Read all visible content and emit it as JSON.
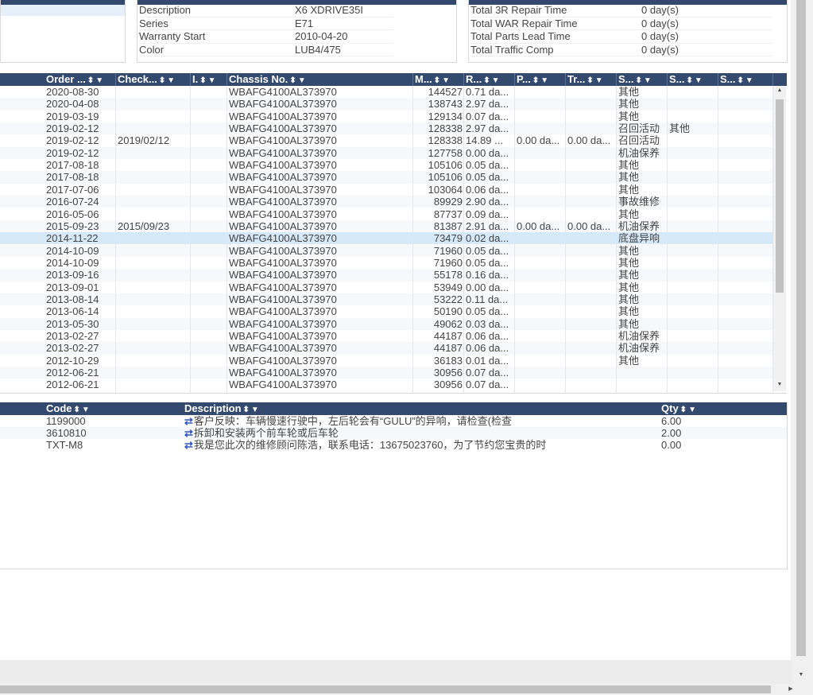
{
  "vehicle_info": {
    "rows": [
      {
        "label": "Description",
        "value": "X6 XDRIVE35I"
      },
      {
        "label": "Series",
        "value": "E71"
      },
      {
        "label": "Warranty Start",
        "value": "2010-04-20"
      },
      {
        "label": "Color",
        "value": "LUB4/475"
      }
    ]
  },
  "totals": {
    "rows": [
      {
        "label": "Total 3R Repair Time",
        "value": "0 day(s)"
      },
      {
        "label": "Total WAR Repair Time",
        "value": "0 day(s)"
      },
      {
        "label": "Total Parts Lead Time",
        "value": "0 day(s)"
      },
      {
        "label": "Total Traffic Comp",
        "value": "0 day(s)"
      }
    ]
  },
  "orders": {
    "headers": [
      "Order ...",
      "Check...",
      "I.",
      "Chassis No.",
      "M...",
      "R...",
      "P...",
      "Tr...",
      "S...",
      "S...",
      "S..."
    ],
    "rows": [
      {
        "order": "2020-08-30",
        "check": "",
        "chassis": "WBAFG4100AL373970",
        "m": "144527",
        "r": "0.71 da...",
        "p": "",
        "tr": "",
        "s1": "其他",
        "s2": ""
      },
      {
        "order": "2020-04-08",
        "check": "",
        "chassis": "WBAFG4100AL373970",
        "m": "138743",
        "r": "2.97 da...",
        "p": "",
        "tr": "",
        "s1": "其他",
        "s2": ""
      },
      {
        "order": "2019-03-19",
        "check": "",
        "chassis": "WBAFG4100AL373970",
        "m": "129134",
        "r": "0.07 da...",
        "p": "",
        "tr": "",
        "s1": "其他",
        "s2": ""
      },
      {
        "order": "2019-02-12",
        "check": "",
        "chassis": "WBAFG4100AL373970",
        "m": "128338",
        "r": "2.97 da...",
        "p": "",
        "tr": "",
        "s1": "召回活动",
        "s2": "其他"
      },
      {
        "order": "2019-02-12",
        "check": "2019/02/12",
        "chassis": "WBAFG4100AL373970",
        "m": "128338",
        "r": "14.89 ...",
        "p": "0.00 da...",
        "tr": "0.00 da...",
        "s1": "召回活动",
        "s2": ""
      },
      {
        "order": "2019-02-12",
        "check": "",
        "chassis": "WBAFG4100AL373970",
        "m": "127758",
        "r": "0.00 da...",
        "p": "",
        "tr": "",
        "s1": "机油保养",
        "s2": ""
      },
      {
        "order": "2017-08-18",
        "check": "",
        "chassis": "WBAFG4100AL373970",
        "m": "105106",
        "r": "0.05 da...",
        "p": "",
        "tr": "",
        "s1": "其他",
        "s2": ""
      },
      {
        "order": "2017-08-18",
        "check": "",
        "chassis": "WBAFG4100AL373970",
        "m": "105106",
        "r": "0.05 da...",
        "p": "",
        "tr": "",
        "s1": "其他",
        "s2": ""
      },
      {
        "order": "2017-07-06",
        "check": "",
        "chassis": "WBAFG4100AL373970",
        "m": "103064",
        "r": "0.06 da...",
        "p": "",
        "tr": "",
        "s1": "其他",
        "s2": ""
      },
      {
        "order": "2016-07-24",
        "check": "",
        "chassis": "WBAFG4100AL373970",
        "m": "89929",
        "r": "2.90 da...",
        "p": "",
        "tr": "",
        "s1": "事故维修",
        "s2": ""
      },
      {
        "order": "2016-05-06",
        "check": "",
        "chassis": "WBAFG4100AL373970",
        "m": "87737",
        "r": "0.09 da...",
        "p": "",
        "tr": "",
        "s1": "其他",
        "s2": ""
      },
      {
        "order": "2015-09-23",
        "check": "2015/09/23",
        "chassis": "WBAFG4100AL373970",
        "m": "81387",
        "r": "2.91 da...",
        "p": "0.00 da...",
        "tr": "0.00 da...",
        "s1": "机油保养",
        "s2": ""
      },
      {
        "order": "2014-11-22",
        "check": "",
        "chassis": "WBAFG4100AL373970",
        "m": "73479",
        "r": "0.02 da...",
        "p": "",
        "tr": "",
        "s1": "底盘异响",
        "s2": ""
      },
      {
        "order": "2014-10-09",
        "check": "",
        "chassis": "WBAFG4100AL373970",
        "m": "71960",
        "r": "0.05 da...",
        "p": "",
        "tr": "",
        "s1": "其他",
        "s2": ""
      },
      {
        "order": "2014-10-09",
        "check": "",
        "chassis": "WBAFG4100AL373970",
        "m": "71960",
        "r": "0.05 da...",
        "p": "",
        "tr": "",
        "s1": "其他",
        "s2": ""
      },
      {
        "order": "2013-09-16",
        "check": "",
        "chassis": "WBAFG4100AL373970",
        "m": "55178",
        "r": "0.16 da...",
        "p": "",
        "tr": "",
        "s1": "其他",
        "s2": ""
      },
      {
        "order": "2013-09-01",
        "check": "",
        "chassis": "WBAFG4100AL373970",
        "m": "53949",
        "r": "0.00 da...",
        "p": "",
        "tr": "",
        "s1": "其他",
        "s2": ""
      },
      {
        "order": "2013-08-14",
        "check": "",
        "chassis": "WBAFG4100AL373970",
        "m": "53222",
        "r": "0.11 da...",
        "p": "",
        "tr": "",
        "s1": "其他",
        "s2": ""
      },
      {
        "order": "2013-06-14",
        "check": "",
        "chassis": "WBAFG4100AL373970",
        "m": "50190",
        "r": "0.05 da...",
        "p": "",
        "tr": "",
        "s1": "其他",
        "s2": ""
      },
      {
        "order": "2013-05-30",
        "check": "",
        "chassis": "WBAFG4100AL373970",
        "m": "49062",
        "r": "0.03 da...",
        "p": "",
        "tr": "",
        "s1": "其他",
        "s2": ""
      },
      {
        "order": "2013-02-27",
        "check": "",
        "chassis": "WBAFG4100AL373970",
        "m": "44187",
        "r": "0.06 da...",
        "p": "",
        "tr": "",
        "s1": "机油保养",
        "s2": ""
      },
      {
        "order": "2013-02-27",
        "check": "",
        "chassis": "WBAFG4100AL373970",
        "m": "44187",
        "r": "0.06 da...",
        "p": "",
        "tr": "",
        "s1": "机油保养",
        "s2": ""
      },
      {
        "order": "2012-10-29",
        "check": "",
        "chassis": "WBAFG4100AL373970",
        "m": "36183",
        "r": "0.01 da...",
        "p": "",
        "tr": "",
        "s1": "其他",
        "s2": ""
      },
      {
        "order": "2012-06-21",
        "check": "",
        "chassis": "WBAFG4100AL373970",
        "m": "30956",
        "r": "0.07 da...",
        "p": "",
        "tr": "",
        "s1": "",
        "s2": ""
      },
      {
        "order": "2012-06-21",
        "check": "",
        "chassis": "WBAFG4100AL373970",
        "m": "30956",
        "r": "0.07 da...",
        "p": "",
        "tr": "",
        "s1": "",
        "s2": ""
      }
    ]
  },
  "jobs": {
    "headers": [
      "Code",
      "Description",
      "Qty"
    ],
    "rows": [
      {
        "code": "1199000",
        "desc": "客户反映：车辆慢速行驶中，左后轮会有“GULU”的异响，请检查(检查",
        "qty": "6.00"
      },
      {
        "code": "3610810",
        "desc": "拆卸和安装两个前车轮或后车轮",
        "qty": "2.00"
      },
      {
        "code": "TXT-M8",
        "desc": "我是您此次的维修顾问陈浩，联系电话：13675023760，为了节约您宝贵的时",
        "qty": "0.00"
      }
    ]
  },
  "glyphs": {
    "sort": "⬍",
    "filter": "▼",
    "swap": "⇄"
  }
}
